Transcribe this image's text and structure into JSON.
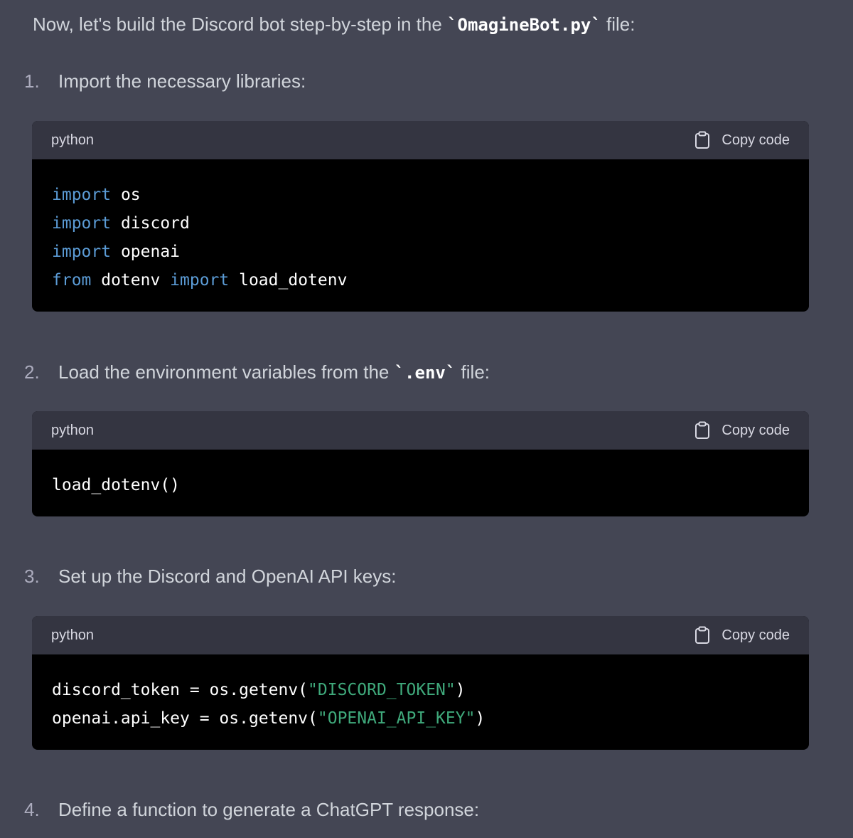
{
  "intro": {
    "text_before": "Now, let's build the Discord bot step-by-step in the ",
    "code": "`OmagineBot.py`",
    "text_after": " file:"
  },
  "steps": [
    {
      "number": "1.",
      "text": "Import the necessary libraries:"
    },
    {
      "number": "2.",
      "text_before": "Load the environment variables from the ",
      "code": "`.env`",
      "text_after": " file:"
    },
    {
      "number": "3.",
      "text": "Set up the Discord and OpenAI API keys:"
    },
    {
      "number": "4.",
      "text": "Define a function to generate a ChatGPT response:"
    }
  ],
  "code_blocks": [
    {
      "language": "python",
      "copy_label": "Copy code",
      "lines": [
        [
          {
            "t": "import",
            "k": "kw"
          },
          {
            "t": " os"
          }
        ],
        [
          {
            "t": "import",
            "k": "kw"
          },
          {
            "t": " discord"
          }
        ],
        [
          {
            "t": "import",
            "k": "kw"
          },
          {
            "t": " openai"
          }
        ],
        [
          {
            "t": "from",
            "k": "kw"
          },
          {
            "t": " dotenv "
          },
          {
            "t": "import",
            "k": "kw"
          },
          {
            "t": " load_dotenv"
          }
        ]
      ]
    },
    {
      "language": "python",
      "copy_label": "Copy code",
      "lines": [
        [
          {
            "t": "load_dotenv()"
          }
        ]
      ]
    },
    {
      "language": "python",
      "copy_label": "Copy code",
      "lines": [
        [
          {
            "t": "discord_token = os.getenv("
          },
          {
            "t": "\"DISCORD_TOKEN\"",
            "k": "str"
          },
          {
            "t": ")"
          }
        ],
        [
          {
            "t": "openai.api_key = os.getenv("
          },
          {
            "t": "\"OPENAI_API_KEY\"",
            "k": "str"
          },
          {
            "t": ")"
          }
        ]
      ]
    }
  ],
  "colors": {
    "page_bg": "#444654",
    "code_bg": "#000000",
    "code_header_bg": "#343541",
    "keyword": "#5b9bd5",
    "string": "#3fa97b"
  },
  "icons": {
    "copy": "clipboard-icon"
  }
}
